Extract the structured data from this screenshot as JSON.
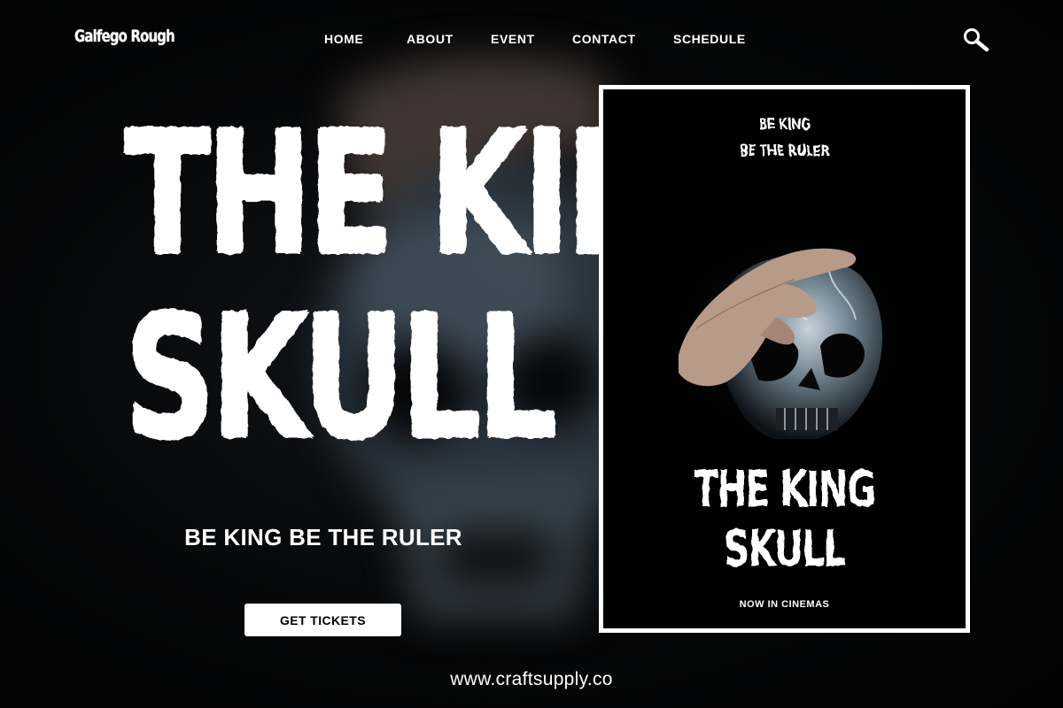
{
  "header": {
    "logo_text": "Galfego Rough",
    "nav": [
      {
        "label": "HOME"
      },
      {
        "label": "ABOUT"
      },
      {
        "label": "EVENT"
      },
      {
        "label": "CONTACT"
      },
      {
        "label": "SCHEDULE"
      }
    ],
    "search_icon": "search-icon"
  },
  "hero": {
    "title_line1": "THE KING",
    "title_line2": "SKULL",
    "tagline": "BE KING BE THE RULER",
    "cta_label": "GET TICKETS"
  },
  "poster": {
    "tag_line1": "BE KING",
    "tag_line2": "BE THE RULER",
    "title_line1": "THE KING",
    "title_line2": "SKULL",
    "footer": "NOW IN CINEMAS"
  },
  "footer": {
    "url": "www.craftsupply.co"
  },
  "colors": {
    "background": "#030303",
    "text": "#ffffff",
    "button_bg": "#ffffff",
    "button_text": "#000000"
  }
}
